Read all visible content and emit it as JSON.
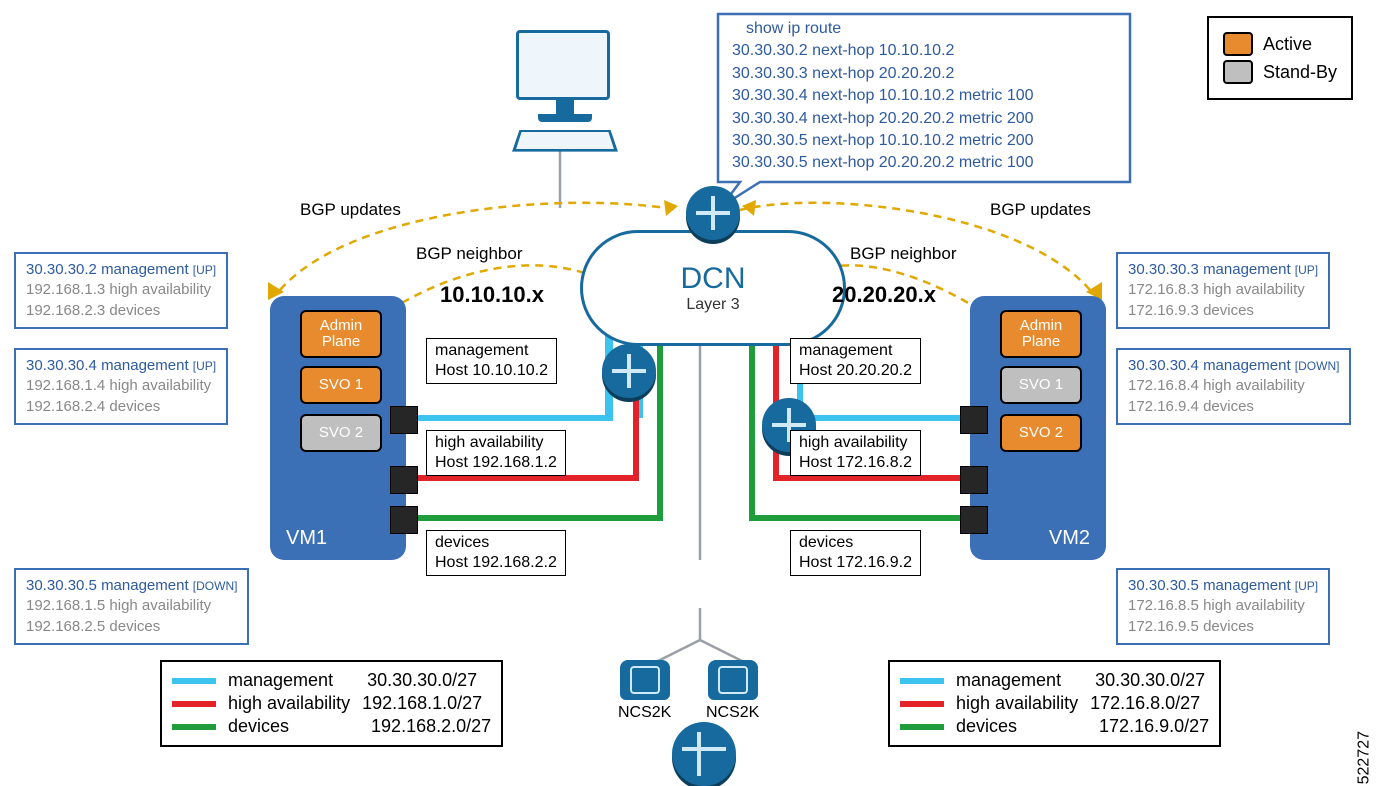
{
  "legend": {
    "active": "Active",
    "standby": "Stand-By"
  },
  "routebox": {
    "title": "show ip route",
    "lines": [
      "30.30.30.2 next-hop 10.10.10.2",
      "30.30.30.3 next-hop 20.20.20.2",
      "30.30.30.4 next-hop 10.10.10.2 metric 100",
      "30.30.30.4 next-hop 20.20.20.2 metric 200",
      "30.30.30.5 next-hop 10.10.10.2 metric 200",
      "30.30.30.5 next-hop 20.20.20.2 metric 100"
    ]
  },
  "bgp": {
    "updates": "BGP updates",
    "neighbor": "BGP neighbor"
  },
  "subnets": {
    "left": "10.10.10.x",
    "right": "20.20.20.x"
  },
  "cloud": {
    "title": "DCN",
    "sub": "Layer 3"
  },
  "vm1": {
    "label": "VM1",
    "nodes": {
      "admin": "Admin Plane",
      "svo1": "SVO 1",
      "svo2": "SVO 2"
    },
    "iface": {
      "mgmt_l1": "management",
      "mgmt_l2": "Host 10.10.10.2",
      "ha_l1": "high availability",
      "ha_l2": "Host 192.168.1.2",
      "dev_l1": "devices",
      "dev_l2": "Host 192.168.2.2"
    },
    "callouts": {
      "admin": {
        "l1": "30.30.30.2 management",
        "status": "[UP]",
        "l2": "192.168.1.3 high availability",
        "l3": "192.168.2.3 devices"
      },
      "svo1": {
        "l1": "30.30.30.4 management",
        "status": "[UP]",
        "l2": "192.168.1.4 high availability",
        "l3": "192.168.2.4 devices"
      },
      "svo2": {
        "l1": "30.30.30.5 management",
        "status": "[DOWN]",
        "l2": "192.168.1.5 high availability",
        "l3": "192.168.2.5 devices"
      }
    }
  },
  "vm2": {
    "label": "VM2",
    "nodes": {
      "admin": "Admin Plane",
      "svo1": "SVO 1",
      "svo2": "SVO 2"
    },
    "iface": {
      "mgmt_l1": "management",
      "mgmt_l2": "Host 20.20.20.2",
      "ha_l1": "high availability",
      "ha_l2": "Host 172.16.8.2",
      "dev_l1": "devices",
      "dev_l2": "Host 172.16.9.2"
    },
    "callouts": {
      "admin": {
        "l1": "30.30.30.3 management",
        "status": "[UP]",
        "l2": "172.16.8.3 high availability",
        "l3": "172.16.9.3 devices"
      },
      "svo1": {
        "l1": "30.30.30.4 management",
        "status": "[DOWN]",
        "l2": "172.16.8.4 high availability",
        "l3": "172.16.9.4 devices"
      },
      "svo2": {
        "l1": "30.30.30.5 management",
        "status": "[UP]",
        "l2": "172.16.8.5 high availability",
        "l3": "172.16.9.5 devices"
      }
    }
  },
  "subnet_legend_left": {
    "mgmt_label": "management",
    "mgmt_net": "30.30.30.0/27",
    "ha_label": "high availability",
    "ha_net": "192.168.1.0/27",
    "dev_label": "devices",
    "dev_net": "192.168.2.0/27"
  },
  "subnet_legend_right": {
    "mgmt_label": "management",
    "mgmt_net": "30.30.30.0/27",
    "ha_label": "high availability",
    "ha_net": "172.16.8.0/27",
    "dev_label": "devices",
    "dev_net": "172.16.9.0/27"
  },
  "ncs": {
    "label": "NCS2K"
  },
  "figure_id": "522727"
}
